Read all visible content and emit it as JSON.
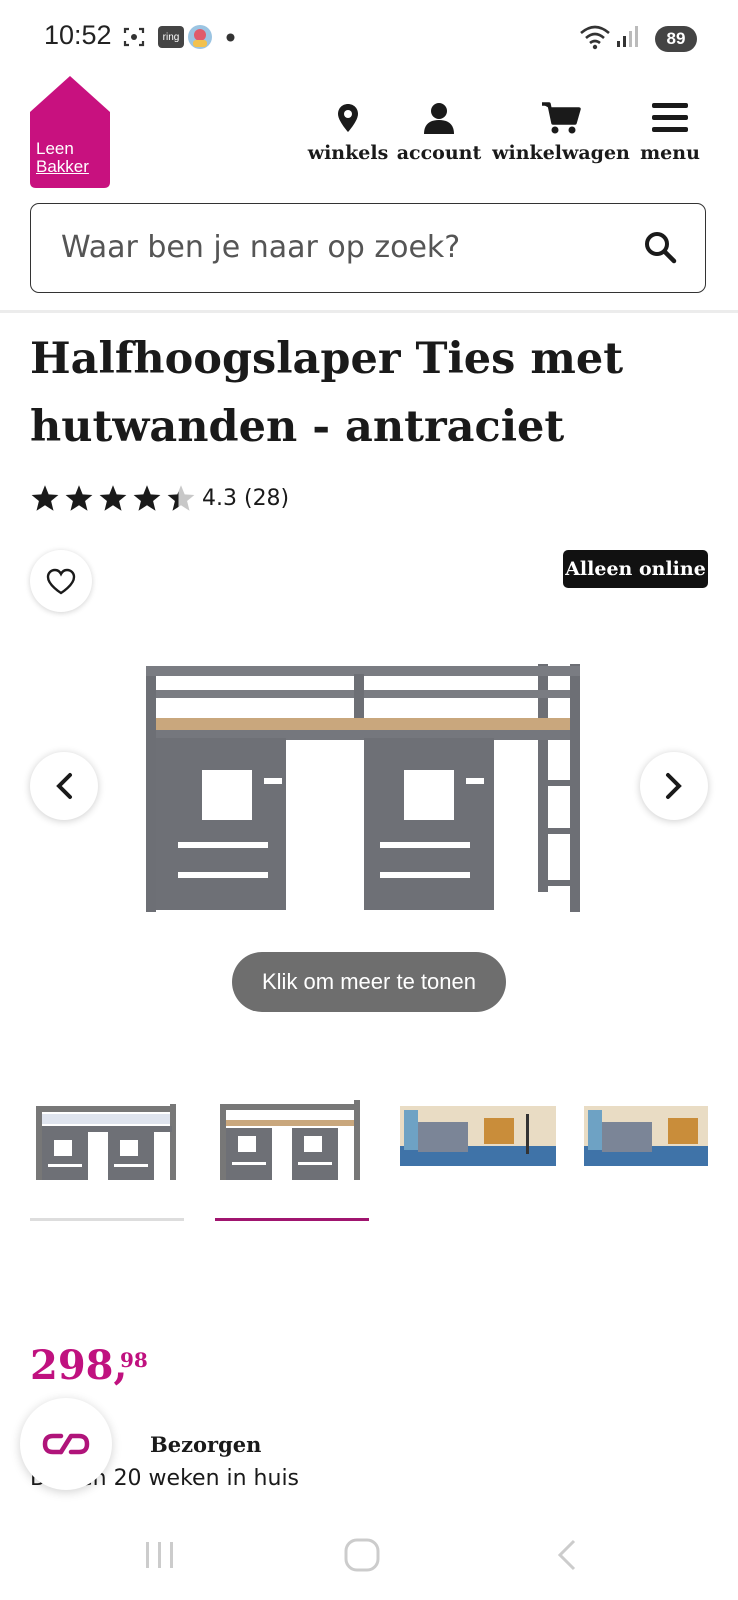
{
  "status_bar": {
    "time": "10:52",
    "ring_label": "ring",
    "battery": "89",
    "icons": [
      "screenshot-icon",
      "ring-app-icon",
      "avatar-icon",
      "notification-dot-icon",
      "wifi-icon",
      "signal-icon",
      "battery-icon"
    ]
  },
  "brand": {
    "logo_line1": "Leen",
    "logo_line2": "Bakker",
    "color": "#c8117f"
  },
  "nav": {
    "stores": "winkels",
    "account": "account",
    "cart": "winkelwagen",
    "menu": "menu"
  },
  "search": {
    "placeholder": "Waar ben je naar op zoek?"
  },
  "product": {
    "title": "Halfhoogslaper Ties met hutwanden - antraciet",
    "rating": 4.3,
    "rating_text": "4.3 (28)",
    "badge": "Alleen online",
    "show_more": "Klik om meer te tonen",
    "price_main": "298,",
    "price_cents": "98",
    "delivery_title": "Bezorgen",
    "delivery_sub": "Binnen 20 weken in huis"
  },
  "thumbnails": {
    "count": 4,
    "active_index": 1,
    "active_color": "#a0156f",
    "inactive_color": "#dddddd"
  }
}
